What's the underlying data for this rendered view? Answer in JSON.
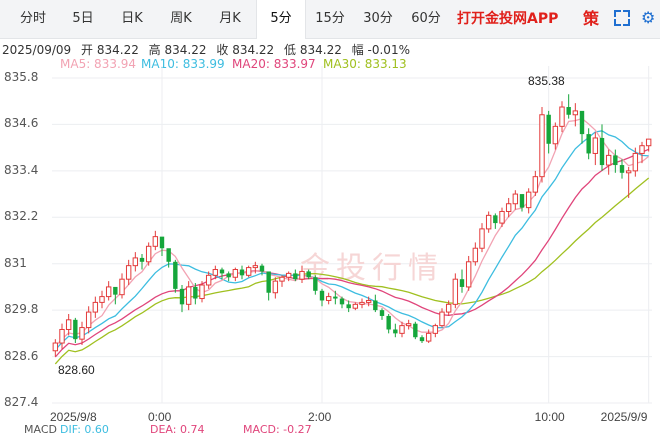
{
  "tabs": [
    {
      "label": "分时",
      "active": false
    },
    {
      "label": "5日",
      "active": false
    },
    {
      "label": "日K",
      "active": false
    },
    {
      "label": "周K",
      "active": false
    },
    {
      "label": "月K",
      "active": false
    },
    {
      "label": "5分",
      "active": true
    },
    {
      "label": "15分",
      "active": false
    },
    {
      "label": "30分",
      "active": false
    },
    {
      "label": "60分",
      "active": false
    }
  ],
  "promo_label": "打开金投网APP",
  "strategy_label": "策",
  "icons": {
    "fullscreen": "fullscreen-icon",
    "settings": "gear-icon"
  },
  "info": {
    "datetime": "2025/09/09",
    "open_label": "开",
    "open": "834.22",
    "high_label": "高",
    "high": "834.22",
    "close_label": "收",
    "close": "834.22",
    "low_label": "低",
    "low": "834.22",
    "change_label": "幅",
    "change": "-0.01%"
  },
  "ma": [
    {
      "label": "MA5: 833.94",
      "color": "#f2a3b3"
    },
    {
      "label": "MA10: 833.99",
      "color": "#3dbde0"
    },
    {
      "label": "MA20: 833.97",
      "color": "#e0457b"
    },
    {
      "label": "MA30: 833.13",
      "color": "#a0c020"
    }
  ],
  "macd": [
    {
      "label": "MACD",
      "color": "#555555"
    },
    {
      "label": "DIF: 0.60",
      "color": "#3dbde0"
    },
    {
      "label": "DEA: 0.74",
      "color": "#e0457b"
    },
    {
      "label": "MACD: -0.27",
      "color": "#e0457b"
    }
  ],
  "watermark": "金投行情",
  "colors": {
    "up": "#e33b3b",
    "down": "#15a63b",
    "accent": "#1f6fd1",
    "brand": "#e0201b"
  },
  "chart_data": {
    "type": "candlestick",
    "ylim": [
      827.4,
      835.8
    ],
    "y_ticks": [
      "835.8",
      "834.6",
      "833.4",
      "832.2",
      "831",
      "829.8",
      "828.6",
      "827.4"
    ],
    "x_tick_labels": [
      "2025/9/8",
      "0:00",
      "2:00",
      "10:00",
      "2025/9/9"
    ],
    "annotations": {
      "high": "835.38",
      "low": "828.60"
    },
    "ohlc": [
      [
        828.75,
        829.05,
        828.6,
        828.95
      ],
      [
        828.95,
        829.45,
        828.8,
        829.3
      ],
      [
        829.3,
        829.7,
        829.15,
        829.55
      ],
      [
        829.55,
        829.6,
        828.95,
        829.05
      ],
      [
        829.05,
        829.5,
        828.9,
        829.35
      ],
      [
        829.35,
        829.9,
        829.2,
        829.75
      ],
      [
        829.75,
        830.15,
        829.6,
        830.0
      ],
      [
        830.0,
        830.3,
        829.85,
        830.15
      ],
      [
        830.15,
        830.55,
        830.05,
        830.4
      ],
      [
        830.4,
        830.35,
        829.95,
        830.2
      ],
      [
        830.2,
        830.75,
        830.1,
        830.6
      ],
      [
        830.6,
        831.1,
        830.45,
        830.95
      ],
      [
        830.95,
        831.3,
        830.8,
        831.15
      ],
      [
        831.15,
        831.25,
        830.85,
        831.05
      ],
      [
        831.05,
        831.55,
        830.95,
        831.45
      ],
      [
        831.45,
        831.85,
        831.35,
        831.7
      ],
      [
        831.7,
        831.6,
        831.2,
        831.4
      ],
      [
        831.4,
        831.35,
        830.9,
        831.05
      ],
      [
        831.05,
        831.1,
        830.25,
        830.35
      ],
      [
        830.35,
        830.45,
        829.75,
        829.95
      ],
      [
        829.95,
        830.55,
        829.8,
        830.4
      ],
      [
        830.4,
        830.5,
        829.95,
        830.1
      ],
      [
        830.1,
        830.55,
        830.0,
        830.45
      ],
      [
        830.45,
        830.8,
        830.35,
        830.7
      ],
      [
        830.7,
        830.95,
        830.6,
        830.85
      ],
      [
        830.85,
        830.9,
        830.6,
        830.75
      ],
      [
        830.75,
        830.8,
        830.55,
        830.65
      ],
      [
        830.65,
        830.9,
        830.55,
        830.85
      ],
      [
        830.85,
        830.95,
        830.6,
        830.7
      ],
      [
        830.7,
        830.95,
        830.65,
        830.9
      ],
      [
        830.9,
        831.05,
        830.75,
        830.95
      ],
      [
        830.95,
        831.0,
        830.7,
        830.8
      ],
      [
        830.8,
        830.75,
        830.05,
        830.25
      ],
      [
        830.25,
        830.65,
        830.1,
        830.55
      ],
      [
        830.55,
        830.7,
        830.4,
        830.65
      ],
      [
        830.65,
        830.8,
        830.55,
        830.75
      ],
      [
        830.75,
        830.85,
        830.55,
        830.6
      ],
      [
        830.6,
        830.95,
        830.5,
        830.8
      ],
      [
        830.8,
        830.85,
        830.6,
        830.65
      ],
      [
        830.65,
        830.7,
        830.2,
        830.3
      ],
      [
        830.3,
        830.35,
        829.9,
        830.05
      ],
      [
        830.05,
        830.25,
        829.95,
        830.15
      ],
      [
        830.15,
        830.3,
        829.95,
        830.1
      ],
      [
        830.1,
        830.15,
        829.85,
        829.95
      ],
      [
        829.95,
        830.05,
        829.75,
        829.85
      ],
      [
        829.85,
        830.0,
        829.8,
        829.95
      ],
      [
        829.95,
        830.1,
        829.85,
        830.0
      ],
      [
        830.0,
        830.15,
        829.9,
        830.05
      ],
      [
        830.05,
        830.2,
        829.75,
        829.8
      ],
      [
        829.8,
        829.85,
        829.55,
        829.65
      ],
      [
        829.65,
        829.7,
        829.2,
        829.3
      ],
      [
        829.3,
        829.45,
        829.1,
        829.2
      ],
      [
        829.2,
        829.5,
        829.1,
        829.4
      ],
      [
        829.4,
        829.55,
        829.3,
        829.45
      ],
      [
        829.45,
        829.5,
        829.05,
        829.1
      ],
      [
        829.1,
        829.15,
        828.95,
        829.0
      ],
      [
        829.0,
        829.3,
        828.95,
        829.2
      ],
      [
        829.2,
        829.45,
        829.1,
        829.4
      ],
      [
        829.4,
        829.85,
        829.35,
        829.75
      ],
      [
        829.75,
        830.05,
        829.65,
        829.95
      ],
      [
        829.95,
        830.75,
        829.85,
        830.6
      ],
      [
        830.6,
        830.85,
        830.25,
        830.4
      ],
      [
        830.4,
        831.2,
        830.3,
        831.05
      ],
      [
        831.05,
        831.55,
        830.95,
        831.4
      ],
      [
        831.4,
        832.05,
        831.3,
        831.9
      ],
      [
        831.9,
        832.35,
        831.8,
        832.25
      ],
      [
        832.25,
        832.3,
        831.9,
        832.05
      ],
      [
        832.05,
        832.45,
        831.95,
        832.35
      ],
      [
        832.35,
        832.7,
        832.2,
        832.55
      ],
      [
        832.55,
        832.9,
        832.4,
        832.8
      ],
      [
        832.8,
        832.7,
        832.35,
        832.45
      ],
      [
        832.45,
        832.95,
        832.3,
        832.85
      ],
      [
        832.85,
        833.4,
        832.75,
        833.25
      ],
      [
        833.25,
        835.05,
        833.1,
        834.85
      ],
      [
        834.85,
        834.95,
        833.85,
        834.1
      ],
      [
        834.1,
        834.65,
        833.95,
        834.55
      ],
      [
        834.55,
        835.2,
        834.4,
        835.05
      ],
      [
        835.05,
        835.38,
        834.75,
        834.85
      ],
      [
        834.85,
        835.15,
        834.55,
        834.95
      ],
      [
        834.95,
        834.9,
        834.1,
        834.35
      ],
      [
        834.35,
        834.5,
        833.7,
        833.85
      ],
      [
        833.85,
        834.4,
        833.55,
        834.25
      ],
      [
        834.25,
        834.6,
        833.4,
        833.55
      ],
      [
        833.55,
        833.95,
        833.3,
        833.8
      ],
      [
        833.8,
        833.95,
        833.35,
        833.55
      ],
      [
        833.55,
        833.7,
        833.2,
        833.35
      ],
      [
        833.35,
        833.5,
        832.7,
        833.4
      ],
      [
        833.4,
        834.0,
        833.25,
        833.85
      ],
      [
        833.85,
        834.15,
        833.6,
        834.05
      ],
      [
        834.05,
        834.2,
        833.9,
        834.22
      ]
    ]
  }
}
